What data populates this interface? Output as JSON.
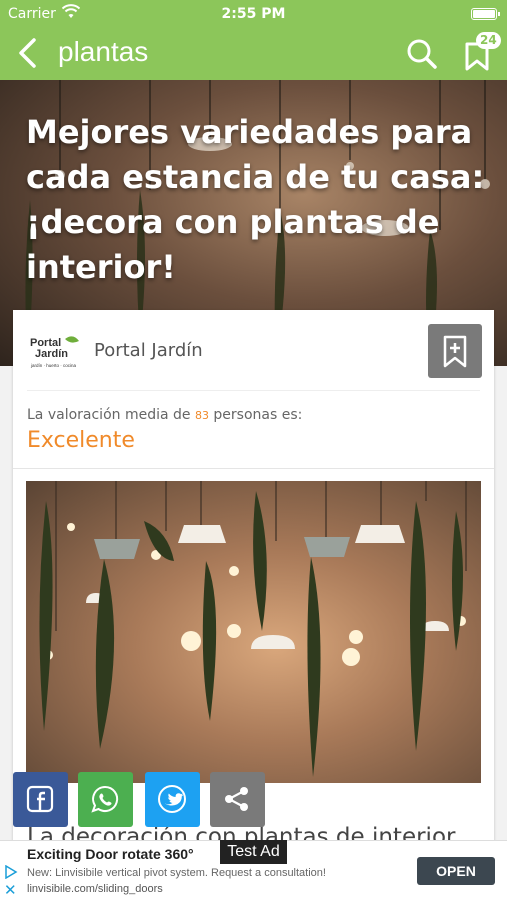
{
  "status_bar": {
    "carrier": "Carrier",
    "time": "2:55 PM"
  },
  "nav": {
    "title": "plantas",
    "saved_count": "24"
  },
  "article": {
    "title": "Mejores variedades para cada estancia de tu casa: ¡decora con plantas de interior!",
    "source_name": "Portal Jardín",
    "source_logo_text": [
      "Portal",
      "Jardín",
      "jardín · huerto · cocina"
    ],
    "rating_prefix": "La valoración media de ",
    "rating_count": "83",
    "rating_suffix": " personas es:",
    "rating_value": "Excelente",
    "body_start": "La decoración con plantas de interior"
  },
  "share": [
    "facebook",
    "whatsapp",
    "twitter",
    "share"
  ],
  "ad": {
    "label": "Test Ad",
    "title": "Exciting Door rotate 360°",
    "description": "New: Linvisibile vertical pivot system. Request a consultation!",
    "url": "linvisibile.com/sliding_doors",
    "cta": "OPEN"
  },
  "colors": {
    "brand_green": "#8cc65a",
    "accent_orange": "#f08a2a",
    "facebook": "#3a5998",
    "whatsapp": "#4caf50",
    "twitter": "#1da1f2"
  }
}
